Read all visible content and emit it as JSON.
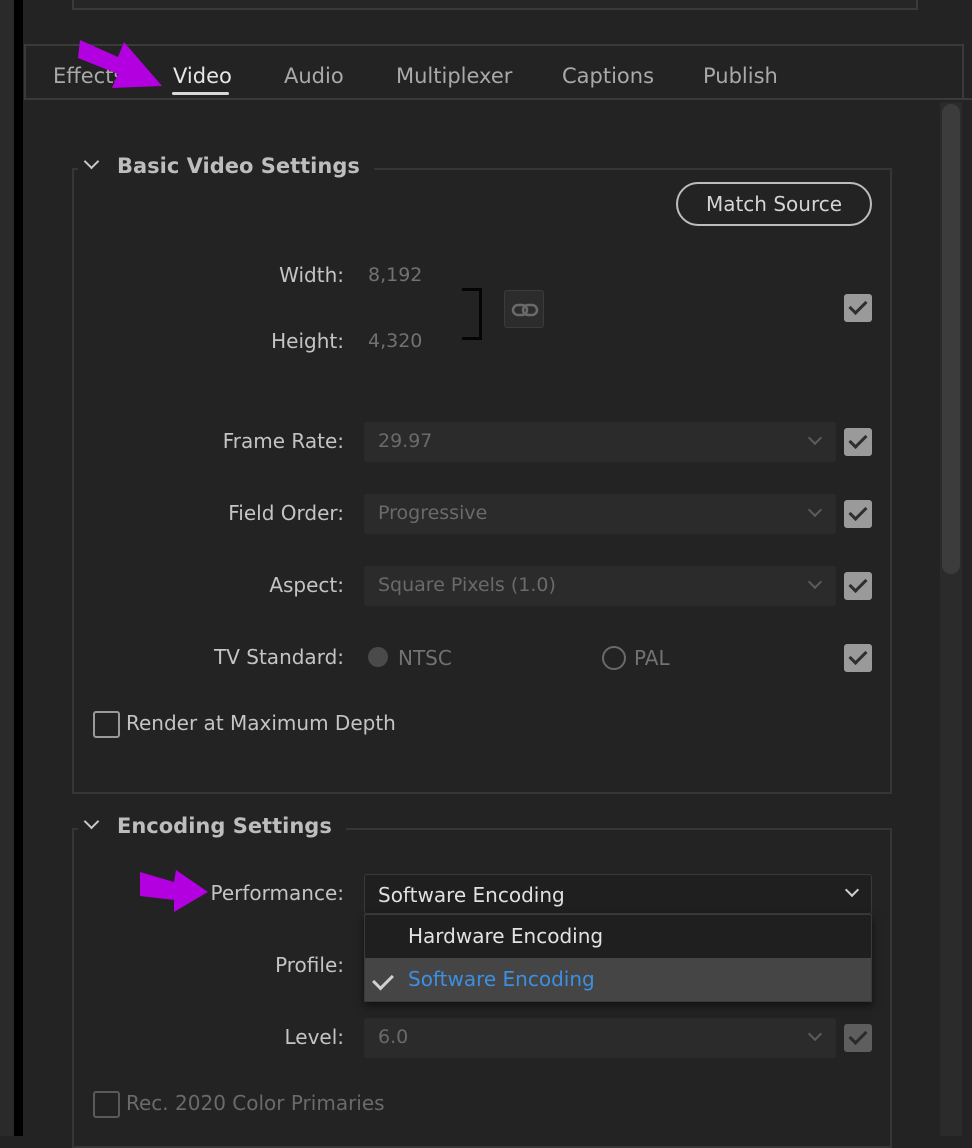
{
  "tabs": [
    {
      "label": "Effects",
      "active": false
    },
    {
      "label": "Video",
      "active": true
    },
    {
      "label": "Audio",
      "active": false
    },
    {
      "label": "Multiplexer",
      "active": false
    },
    {
      "label": "Captions",
      "active": false
    },
    {
      "label": "Publish",
      "active": false
    }
  ],
  "basic": {
    "title": "Basic Video Settings",
    "match_source": "Match Source",
    "width_label": "Width:",
    "width_value": "8,192",
    "height_label": "Height:",
    "height_value": "4,320",
    "frame_rate_label": "Frame Rate:",
    "frame_rate_value": "29.97",
    "field_order_label": "Field Order:",
    "field_order_value": "Progressive",
    "aspect_label": "Aspect:",
    "aspect_value": "Square Pixels (1.0)",
    "tv_standard_label": "TV Standard:",
    "tv_ntsc": "NTSC",
    "tv_pal": "PAL",
    "render_max_depth": "Render at Maximum Depth"
  },
  "encoding": {
    "title": "Encoding Settings",
    "performance_label": "Performance:",
    "performance_value": "Software Encoding",
    "options": [
      "Hardware Encoding",
      "Software Encoding"
    ],
    "selected_option": "Software Encoding",
    "profile_label": "Profile:",
    "level_label": "Level:",
    "level_value": "6.0",
    "rec2020": "Rec. 2020 Color Primaries"
  },
  "colors": {
    "annotation_arrow": "#b300e0",
    "selected_option": "#3d8fe0"
  },
  "icons": [
    "chevron-down-icon",
    "link-icon",
    "checkmark-icon",
    "arrow-annotation"
  ]
}
